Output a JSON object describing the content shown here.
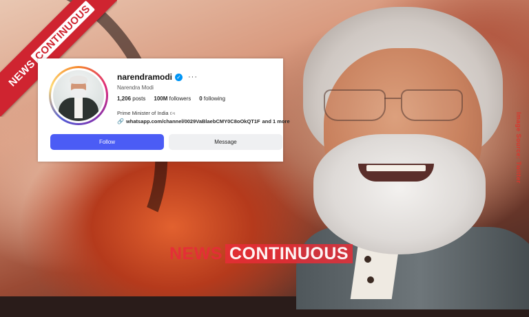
{
  "profile": {
    "username": "narendramodi",
    "verified_icon": "verified-badge-icon",
    "more_label": "···",
    "full_name": "Narendra Modi",
    "posts_count": "1,206",
    "posts_label": "posts",
    "followers_count": "100M",
    "followers_label": "followers",
    "following_count": "0",
    "following_label": "following",
    "bio": "Prime Minister of India",
    "bio_tail": "દવ",
    "link": "whatsapp.com/channel/0029VaBlaebCMY0C8oOkQT1F",
    "link_more": "and 1 more",
    "follow_label": "Follow",
    "message_label": "Message"
  },
  "branding": {
    "ribbon_news": "NEWS",
    "ribbon_continuous": "CONTINUOUS",
    "watermark_news": "NEWS",
    "watermark_continuous": "CONTINUOUS",
    "credit": "Image Source: Twitter"
  },
  "colors": {
    "accent": "#cf2430",
    "follow_button": "#4b5cf5",
    "verified": "#0095f6"
  }
}
